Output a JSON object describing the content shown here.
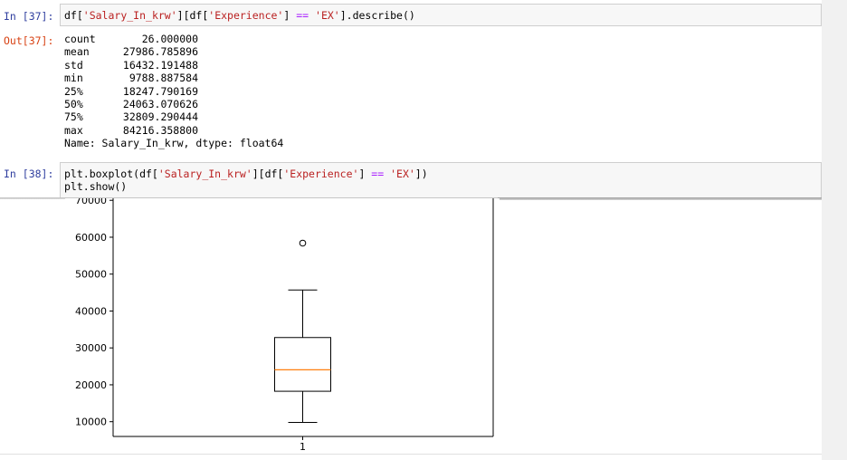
{
  "cells": [
    {
      "prompt": "In [37]:",
      "code": {
        "p1": "df[",
        "s1": "'Salary_In_krw'",
        "p2": "][df[",
        "s2": "'Experience'",
        "p3": "] ",
        "op": "==",
        "p4": " ",
        "s3": "'EX'",
        "p5": "].describe()"
      },
      "out_prompt": "Out[37]:",
      "output_rows": [
        {
          "key": "count",
          "value": "26.000000"
        },
        {
          "key": "mean",
          "value": "27986.785896"
        },
        {
          "key": "std",
          "value": "16432.191488"
        },
        {
          "key": "min",
          "value": "9788.887584"
        },
        {
          "key": "25%",
          "value": "18247.790169"
        },
        {
          "key": "50%",
          "value": "24063.070626"
        },
        {
          "key": "75%",
          "value": "32809.290444"
        },
        {
          "key": "max",
          "value": "84216.358800"
        }
      ],
      "output_footer": "Name: Salary_In_krw, dtype: float64"
    },
    {
      "prompt": "In [38]:",
      "code": {
        "p1": "plt.boxplot(df[",
        "s1": "'Salary_In_krw'",
        "p2": "][df[",
        "s2": "'Experience'",
        "p3": "] ",
        "op": "==",
        "p4": " ",
        "s3": "'EX'",
        "p5": "])"
      },
      "code_line2": "plt.show()"
    }
  ],
  "chart_data": {
    "type": "boxplot",
    "categories": [
      "1"
    ],
    "y_ticks": [
      "10000",
      "20000",
      "30000",
      "40000",
      "50000",
      "60000",
      "70000"
    ],
    "ylim": [
      6000,
      73000
    ],
    "box": {
      "whisker_low": 9800,
      "q1": 18250,
      "median": 24060,
      "q3": 32810,
      "whisker_high": 45700,
      "outliers": [
        58400
      ]
    },
    "colors": {
      "box": "#000000",
      "median": "#ff7f0e",
      "outlier_edge": "#000000"
    }
  }
}
